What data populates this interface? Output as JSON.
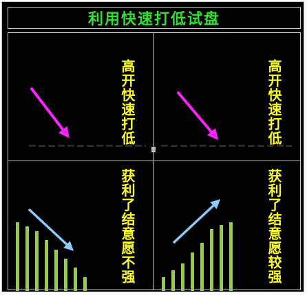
{
  "title": "利用快速打低试盘",
  "panels": {
    "top_left_text": "高开快速打低",
    "top_right_text": "高开快速打低",
    "bottom_left_text": "获利了结意愿不强",
    "bottom_right_text": "获利了结意愿较强"
  },
  "colors": {
    "background": "#000000",
    "title": "#2fe02f",
    "text": "#ffff22",
    "magenta_arrow": "#ff22ff",
    "blue_arrow": "#88ccff",
    "bars": "#8fd13f"
  },
  "bars": {
    "bottom_left_heights": [
      100,
      94,
      87,
      74,
      60,
      47,
      34,
      20
    ],
    "bottom_right_heights": [
      20,
      30,
      40,
      56,
      70,
      90,
      96,
      100
    ]
  }
}
